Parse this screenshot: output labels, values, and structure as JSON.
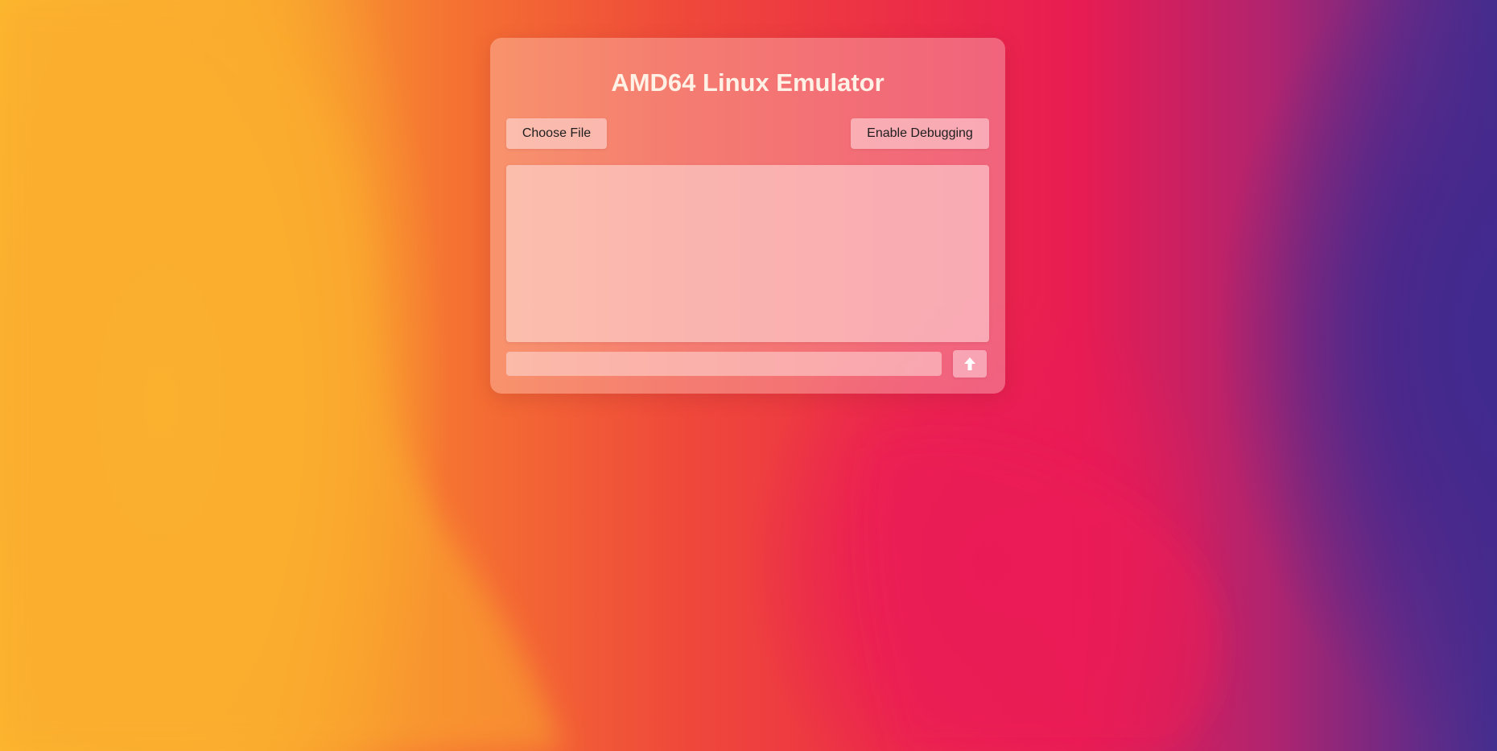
{
  "app": {
    "title": "AMD64 Linux Emulator"
  },
  "toolbar": {
    "choose_file_label": "Choose File",
    "enable_debugging_label": "Enable Debugging"
  },
  "terminal": {
    "output_text": ""
  },
  "command": {
    "value": "",
    "placeholder": "",
    "send_icon": "arrow-up-icon"
  },
  "colors": {
    "background_left": "#fdbb2d",
    "background_mid": "#ef4a3a",
    "background_pink": "#e81c52",
    "background_right": "#432e8e",
    "title_text": "#fff1e6"
  }
}
